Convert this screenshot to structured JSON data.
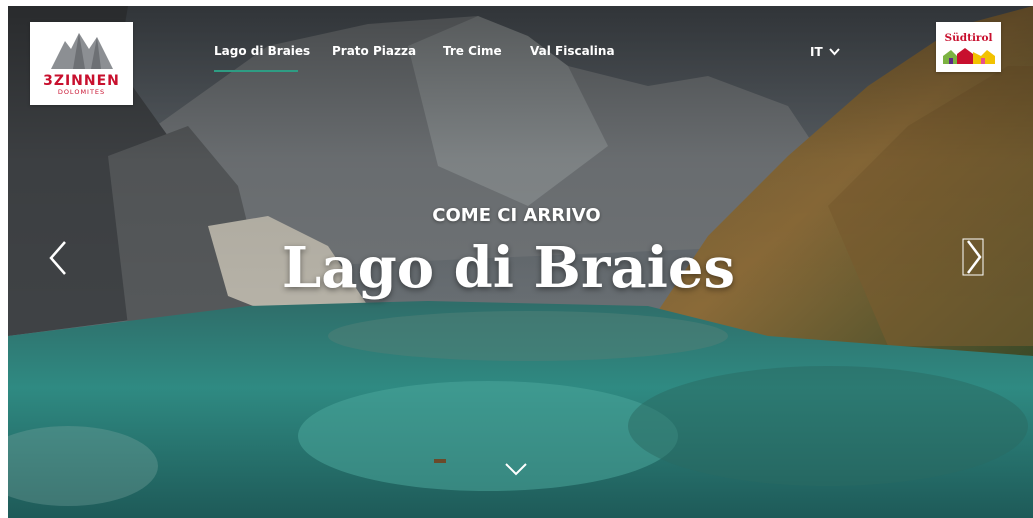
{
  "logo_left": {
    "brand": "3ZINNEN",
    "subtitle": "DOLOMITES"
  },
  "logo_right": {
    "brand": "Südtirol"
  },
  "nav": {
    "items": [
      {
        "label": "Lago di Braies",
        "active": true
      },
      {
        "label": "Prato Piazza",
        "active": false
      },
      {
        "label": "Tre Cime",
        "active": false
      },
      {
        "label": "Val Fiscalina",
        "active": false
      }
    ]
  },
  "language": {
    "label": "IT",
    "icon": "chevron-down-icon"
  },
  "hero": {
    "eyebrow": "COME CI ARRIVO",
    "title": "Lago di Braies"
  },
  "controls": {
    "prev_icon": "chevron-left-icon",
    "next_icon": "chevron-right-icon",
    "scroll_icon": "chevron-down-icon"
  },
  "colors": {
    "accent": "#2e9c83",
    "brand_red": "#c8102e"
  }
}
